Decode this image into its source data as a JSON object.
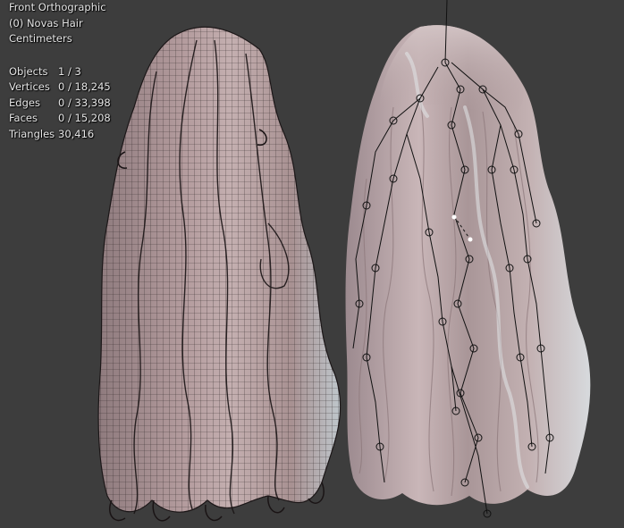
{
  "viewport": {
    "view_name": "Front Orthographic",
    "object_name": "(0) Novas Hair",
    "units": "Centimeters"
  },
  "stats": [
    {
      "label": "Objects",
      "value": "1 / 3"
    },
    {
      "label": "Vertices",
      "value": "0 / 18,245"
    },
    {
      "label": "Edges",
      "value": "0 / 33,398"
    },
    {
      "label": "Faces",
      "value": "0 / 15,208"
    },
    {
      "label": "Triangles",
      "value": "30,416"
    }
  ],
  "colors": {
    "background": "#3d3d3d",
    "hair": "#b79e9e",
    "wire": "#262020",
    "bone": "#111111"
  }
}
